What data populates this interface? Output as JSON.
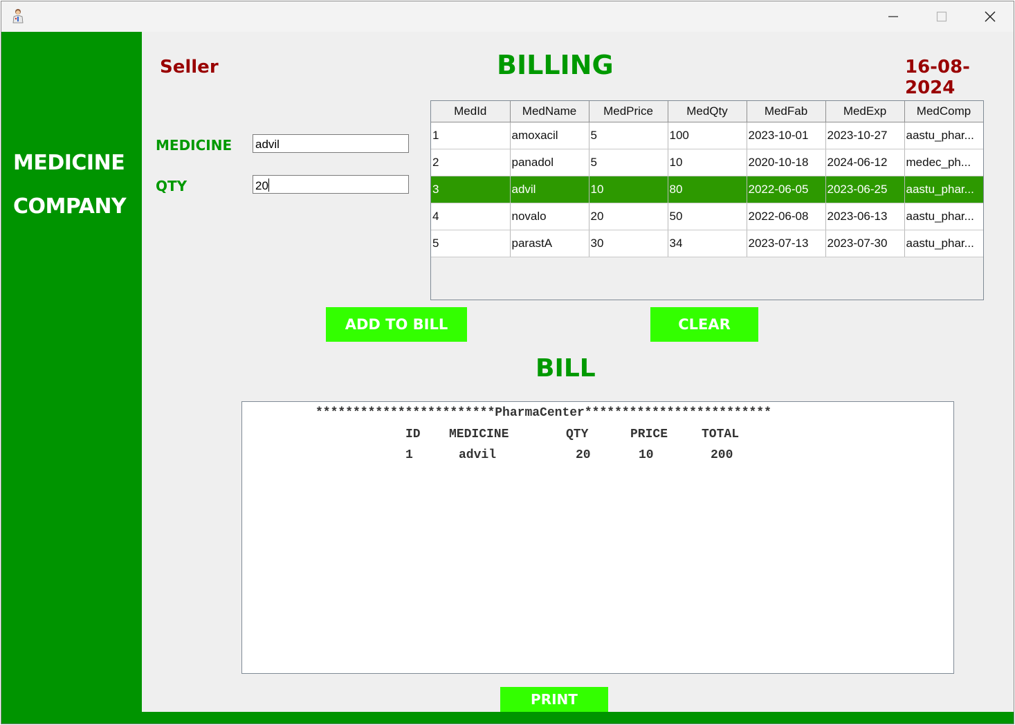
{
  "window": {
    "title": "",
    "controls": [
      "minimize",
      "maximize",
      "close"
    ]
  },
  "sidebar": {
    "line1": "MEDICINE",
    "line2": "COMPANY"
  },
  "header": {
    "seller": "Seller",
    "title": "BILLING",
    "date": "16-08-2024"
  },
  "form": {
    "medicine_label": "MEDICINE",
    "medicine_value": "advil",
    "qty_label": "QTY",
    "qty_value": "20"
  },
  "table": {
    "columns": [
      "MedId",
      "MedName",
      "MedPrice",
      "MedQty",
      "MedFab",
      "MedExp",
      "MedComp"
    ],
    "rows": [
      [
        "1",
        "amoxacil",
        "5",
        "100",
        "2023-10-01",
        "2023-10-27",
        "aastu_phar..."
      ],
      [
        "2",
        "panadol",
        "5",
        "10",
        "2020-10-18",
        "2024-06-12",
        "medec_ph..."
      ],
      [
        "3",
        "advil",
        "10",
        "80",
        "2022-06-05",
        "2023-06-25",
        "aastu_phar..."
      ],
      [
        "4",
        "novalo",
        "20",
        "50",
        "2022-06-08",
        "2023-06-13",
        "aastu_phar..."
      ],
      [
        "5",
        "parastA",
        "30",
        "34",
        "2023-07-13",
        "2023-07-30",
        "aastu_phar..."
      ]
    ],
    "selected_row": 3
  },
  "buttons": {
    "add_to_bill": "ADD TO BILL",
    "clear": "CLEAR",
    "print": "PRINT"
  },
  "bill": {
    "title": "BILL",
    "banner": "************************PharmaCenter*************************",
    "headers": {
      "id": "ID",
      "medicine": "MEDICINE",
      "qty": "QTY",
      "price": "PRICE",
      "total": "TOTAL"
    },
    "lines": [
      {
        "id": "1",
        "medicine": "advil",
        "qty": "20",
        "price": "10",
        "total": "200"
      }
    ]
  },
  "colors": {
    "sidebar_green": "#009400",
    "title_green": "#009900",
    "button_green": "#33ff00",
    "selected_row": "#2d9900",
    "seller_red": "#990000"
  },
  "icons": [
    "app-doctor-icon",
    "minimize-icon",
    "maximize-icon",
    "close-icon"
  ]
}
